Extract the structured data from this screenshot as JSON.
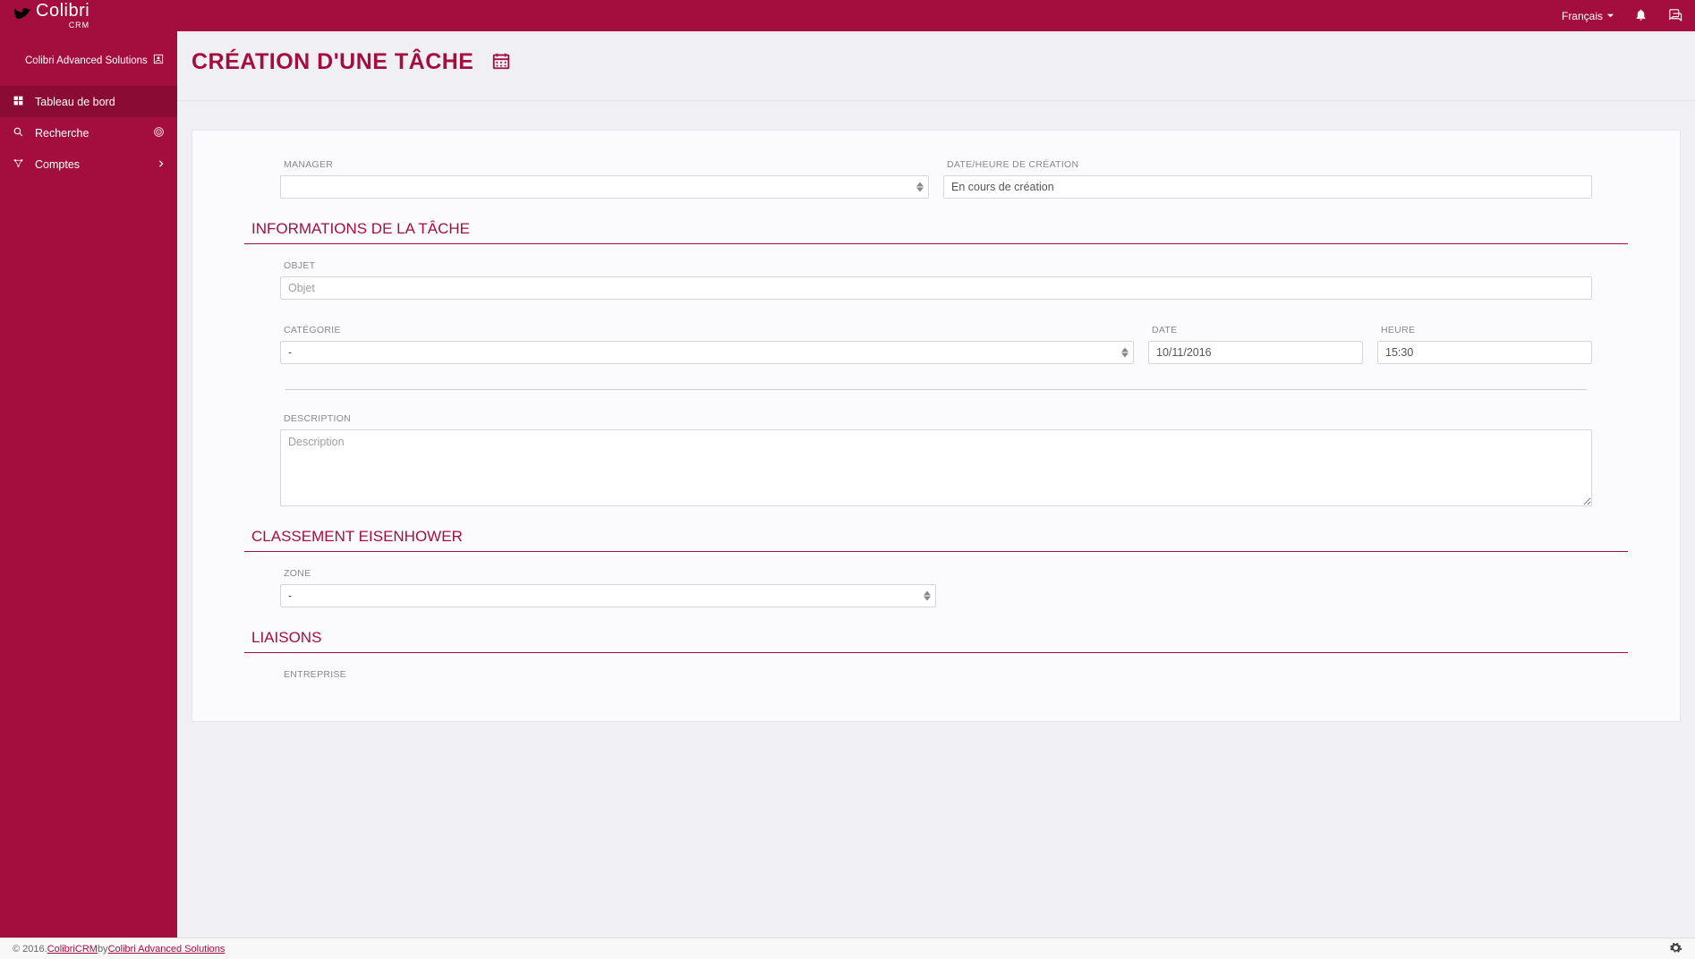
{
  "brand": {
    "name": "Colibri",
    "sub": "CRM"
  },
  "top": {
    "language": "Français"
  },
  "sidebar": {
    "org": "Colibri Advanced Solutions",
    "items": [
      {
        "label": "Tableau de bord"
      },
      {
        "label": "Recherche"
      },
      {
        "label": "Comptes"
      }
    ]
  },
  "page": {
    "title": "CRÉATION D'UNE TÂCHE"
  },
  "form": {
    "manager_label": "MANAGER",
    "manager_value": "",
    "creation_dt_label": "DATE/HEURE DE CRÉATION",
    "creation_dt_value": "En cours de création",
    "section_info": "INFORMATIONS DE LA TÂCHE",
    "objet_label": "OBJET",
    "objet_placeholder": "Objet",
    "categorie_label": "CATÉGORIE",
    "categorie_value": "-",
    "date_label": "DATE",
    "date_value": "10/11/2016",
    "heure_label": "HEURE",
    "heure_value": "15:30",
    "desc_label": "DESCRIPTION",
    "desc_placeholder": "Description",
    "section_eisen": "CLASSEMENT EISENHOWER",
    "zone_label": "ZONE",
    "zone_value": "-",
    "section_liaisons": "LIAISONS",
    "entreprise_label": "ENTREPRISE"
  },
  "footer": {
    "prefix": "© 2016. ",
    "link1": "ColibriCRM",
    "mid": " by ",
    "link2": "Colibri Advanced Solutions"
  }
}
